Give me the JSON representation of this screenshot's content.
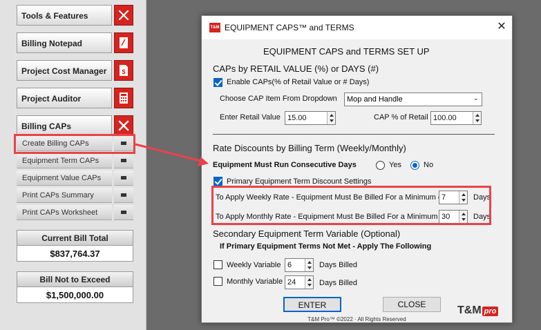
{
  "sidebar": {
    "menu": [
      {
        "label": "Tools & Features",
        "icon": "tools-icon"
      },
      {
        "label": "Billing Notepad",
        "icon": "notepad-icon"
      },
      {
        "label": "Project Cost Manager",
        "icon": "dollar-document-icon"
      },
      {
        "label": "Project Auditor",
        "icon": "calculator-icon"
      },
      {
        "label": "Billing CAPs",
        "icon": "close-icon"
      }
    ],
    "sub_items": [
      {
        "label": "Create Billing CAPs"
      },
      {
        "label": "Equipment Term CAPs"
      },
      {
        "label": "Equipment Value CAPs"
      },
      {
        "label": "Print CAPs Summary"
      },
      {
        "label": "Print CAPs Worksheet"
      }
    ],
    "current_bill": {
      "title": "Current Bill Total",
      "value": "$837,764.37"
    },
    "bill_not_to_exceed": {
      "title": "Bill Not to Exceed",
      "value": "$1,500,000.00"
    }
  },
  "dialog": {
    "logo_text": "T&M",
    "title": "EQUIPMENT CAPS™ and TERMS",
    "heading": "EQUIPMENT CAPS and TERMS SET UP",
    "caps_section": {
      "title": "CAPs by RETAIL VALUE (%) or DAYS (#)",
      "enable_label": "Enable CAPs(% of Retail Value or # Days)",
      "enable_checked": true,
      "choose_label": "Choose CAP Item From Dropdown",
      "choose_value": "Mop  and Handle",
      "retail_label": "Enter Retail Value",
      "retail_value": "15.00",
      "cap_pct_label": "CAP % of Retail",
      "cap_pct_value": "100.00"
    },
    "rate_section": {
      "title": "Rate Discounts by Billing Term (Weekly/Monthly)",
      "consecutive_label": "Equipment Must Run Consecutive Days",
      "yes_label": "Yes",
      "no_label": "No",
      "selected": "No",
      "primary_label": "Primary Equipment Term Discount Settings",
      "primary_checked": true,
      "weekly_label": "To Apply Weekly Rate - Equipment Must Be Billed For a Minimum of",
      "weekly_value": "7",
      "monthly_label": "To Apply Monthly Rate - Equipment Must Be Billed For a Minimum of",
      "monthly_value": "30",
      "days_label": "Days"
    },
    "secondary_section": {
      "title": "Secondary Equipment Term Variable (Optional)",
      "subtitle": "If Primary Equipment Terms Not Met - Apply The Following",
      "weekly_label": "Weekly Variable",
      "weekly_value": "6",
      "monthly_label": "Monthly Variable",
      "monthly_value": "24",
      "days_billed_label": "Days Billed"
    },
    "enter_label": "ENTER",
    "close_label": "CLOSE",
    "brand": "T&M",
    "brand_pro": "pro",
    "copyright": "T&M Pro™ ©2022 · All Rights Reserved"
  },
  "colors": {
    "accent": "#0a64c9",
    "brand_red": "#d6231e",
    "highlight": "#e8434a"
  }
}
